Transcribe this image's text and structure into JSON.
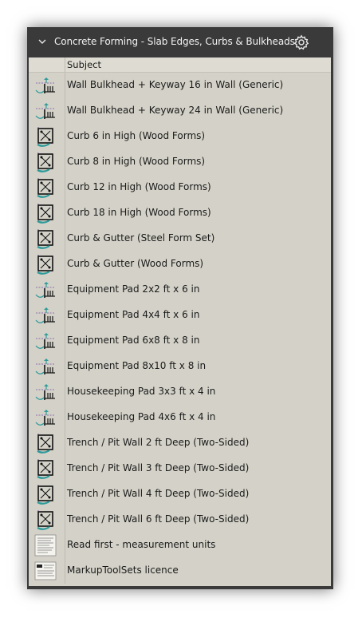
{
  "panel": {
    "title": "Concrete Forming - Slab Edges, Curbs & Bulkheads",
    "column_header": "Subject"
  },
  "items": [
    {
      "label": "Wall Bulkhead + Keyway 16 in Wall (Generic)",
      "icon": "bulkhead-icon"
    },
    {
      "label": "Wall Bulkhead + Keyway 24 in Wall (Generic)",
      "icon": "bulkhead-icon"
    },
    {
      "label": "Curb 6 in High (Wood Forms)",
      "icon": "curb-icon"
    },
    {
      "label": "Curb 8 in High (Wood Forms)",
      "icon": "curb-icon"
    },
    {
      "label": "Curb 12 in High (Wood Forms)",
      "icon": "curb-icon"
    },
    {
      "label": "Curb 18 in High (Wood Forms)",
      "icon": "curb-icon"
    },
    {
      "label": "Curb & Gutter (Steel Form Set)",
      "icon": "curb-icon"
    },
    {
      "label": "Curb & Gutter (Wood Forms)",
      "icon": "curb-icon"
    },
    {
      "label": "Equipment Pad 2x2 ft x 6 in",
      "icon": "bulkhead-icon"
    },
    {
      "label": "Equipment Pad 4x4 ft x 6 in",
      "icon": "bulkhead-icon"
    },
    {
      "label": "Equipment Pad 6x8 ft x 8 in",
      "icon": "bulkhead-icon"
    },
    {
      "label": "Equipment Pad 8x10 ft x 8 in",
      "icon": "bulkhead-icon"
    },
    {
      "label": "Housekeeping Pad 3x3 ft x 4 in",
      "icon": "bulkhead-icon"
    },
    {
      "label": "Housekeeping Pad 4x6 ft x 4 in",
      "icon": "bulkhead-icon"
    },
    {
      "label": "Trench / Pit Wall 2 ft Deep (Two-Sided)",
      "icon": "curb-icon"
    },
    {
      "label": "Trench / Pit Wall 3 ft Deep (Two-Sided)",
      "icon": "curb-icon"
    },
    {
      "label": "Trench / Pit Wall 4 ft Deep (Two-Sided)",
      "icon": "curb-icon"
    },
    {
      "label": "Trench / Pit Wall 6 ft Deep (Two-Sided)",
      "icon": "curb-icon"
    },
    {
      "label": "Read first - measurement units",
      "icon": "document-icon"
    },
    {
      "label": "MarkupToolSets licence",
      "icon": "licence-document-icon"
    }
  ],
  "colors": {
    "header_bg": "#3a3a3a",
    "list_bg": "#d4d2c8",
    "accent_teal": "#2e9a9a",
    "accent_purple": "#7a4fa0"
  }
}
